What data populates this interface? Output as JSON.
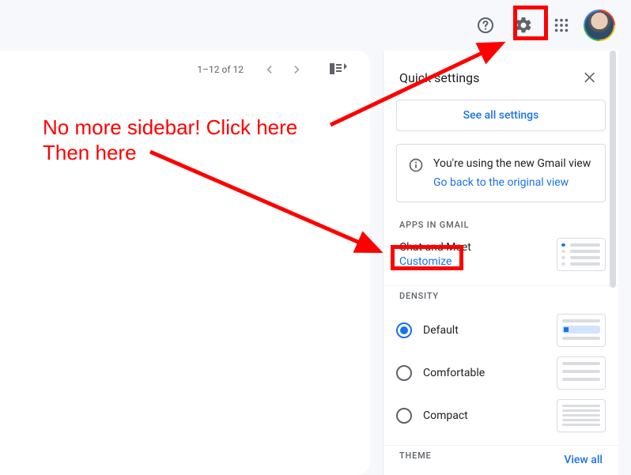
{
  "header": {
    "help_icon": "help-icon",
    "settings_icon": "gear-icon",
    "apps_icon": "apps-grid-icon",
    "avatar": "user-avatar"
  },
  "mail": {
    "page_count": "1–12 of 12"
  },
  "panel": {
    "title": "Quick settings",
    "see_all": "See all settings",
    "info_line1": "You're using the new Gmail view",
    "info_link": "Go back to the original view",
    "sections": {
      "apps_label": "APPS IN GMAIL",
      "chat_meet": "Chat and Meet",
      "customize": "Customize",
      "density_label": "DENSITY",
      "density_options": {
        "default": "Default",
        "comfortable": "Comfortable",
        "compact": "Compact"
      },
      "theme_label": "THEME",
      "view_all": "View all"
    }
  },
  "annotation": {
    "line1": "No more sidebar! Click here",
    "line2": "Then here"
  }
}
